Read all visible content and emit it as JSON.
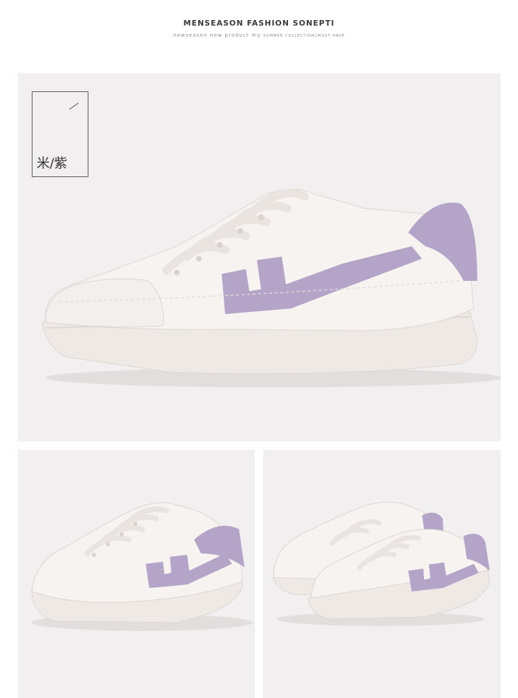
{
  "header": {
    "title": "MENSEASON FASHION SONEPTI",
    "subtitle_main": "newseason new product my",
    "subtitle_small": "SUMMER COLLECTION│MUST HAVE"
  },
  "color_tag": {
    "label": "米/紫"
  },
  "colors": {
    "panel_bg": "#f1efef",
    "shoe_white": "#f5f1ee",
    "sole": "#efe9e5",
    "accent_purple": "#b3a4c8"
  },
  "images": [
    {
      "name": "main-shoe-side-view"
    },
    {
      "name": "shoe-angle-view"
    },
    {
      "name": "shoe-pair-view"
    }
  ]
}
